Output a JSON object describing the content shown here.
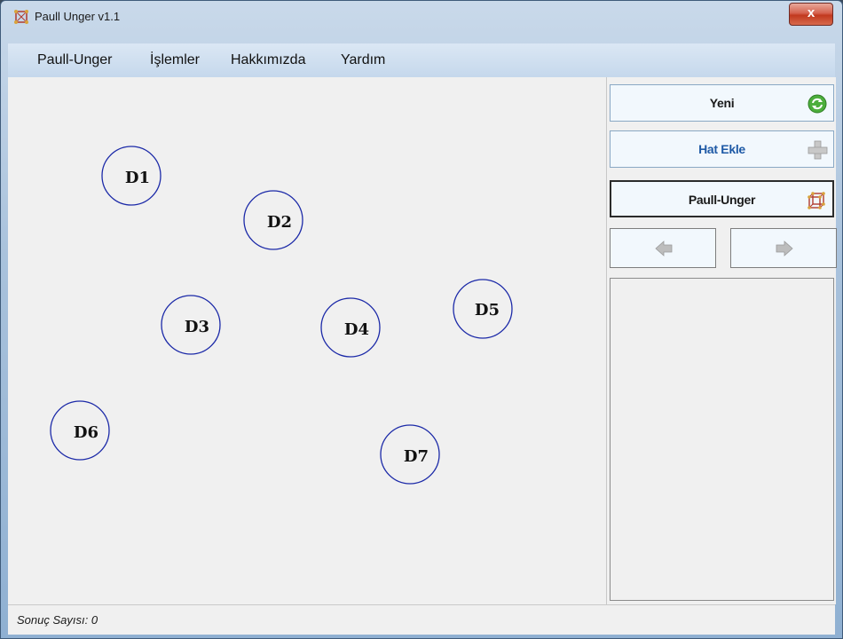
{
  "window": {
    "title": "Paull Unger v1.1",
    "close_label": "x"
  },
  "menu": {
    "items": [
      {
        "label": "Paull-Unger"
      },
      {
        "label": "İşlemler"
      },
      {
        "label": "Hakkımızda"
      },
      {
        "label": "Yardım"
      }
    ]
  },
  "canvas": {
    "nodes": [
      {
        "label": "D1"
      },
      {
        "label": "D2"
      },
      {
        "label": "D3"
      },
      {
        "label": "D4"
      },
      {
        "label": "D5"
      },
      {
        "label": "D6"
      },
      {
        "label": "D7"
      }
    ],
    "node_color": "#1c2aa8"
  },
  "sidebar": {
    "new_button": {
      "label": "Yeni",
      "icon": "refresh-icon"
    },
    "add_line_button": {
      "label": "Hat Ekle",
      "icon": "plus-icon"
    },
    "paull_unger_button": {
      "label": "Paull-Unger",
      "icon": "cube-icon"
    },
    "prev_button": {
      "icon": "arrow-left-icon"
    },
    "next_button": {
      "icon": "arrow-right-icon"
    }
  },
  "status": {
    "text": "Sonuç Sayısı: 0"
  }
}
